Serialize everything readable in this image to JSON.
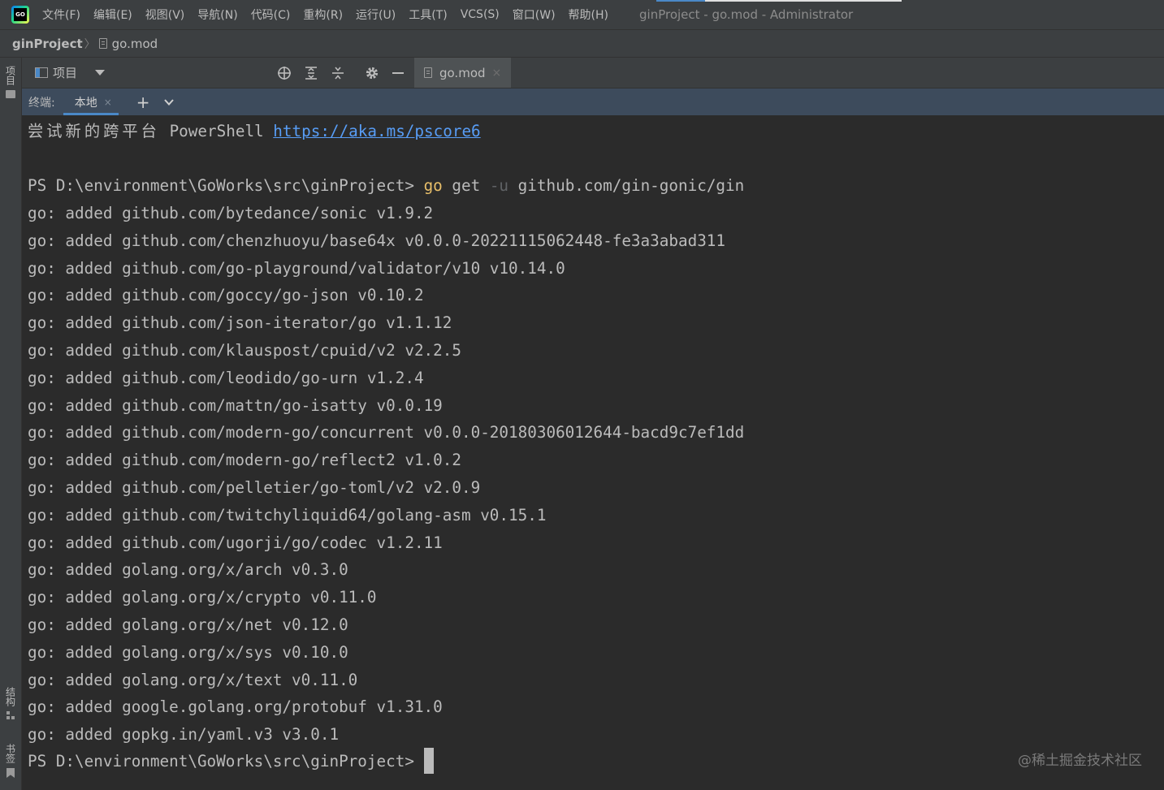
{
  "menubar": {
    "items": [
      "文件(F)",
      "编辑(E)",
      "视图(V)",
      "导航(N)",
      "代码(C)",
      "重构(R)",
      "运行(U)",
      "工具(T)",
      "VCS(S)",
      "窗口(W)",
      "帮助(H)"
    ],
    "window_title": "ginProject - go.mod - Administrator"
  },
  "breadcrumb": {
    "project": "ginProject",
    "file": "go.mod"
  },
  "left_stripe": {
    "project_label": "项目",
    "structure_label": "结构",
    "bookmarks_label": "书签"
  },
  "project_panel": {
    "title": "项目"
  },
  "editor": {
    "tab_label": "go.mod"
  },
  "terminal_header": {
    "label": "终端:",
    "tab_label": "本地"
  },
  "terminal": {
    "intro_text": "尝试新的跨平台",
    "intro_mid": " PowerShell ",
    "intro_link": "https://aka.ms/pscore6",
    "prompt": "PS D:\\environment\\GoWorks\\src\\ginProject> ",
    "command_name": "go",
    "command_sub": " get ",
    "command_flag": "-u",
    "command_arg": " github.com/gin-gonic/gin",
    "output_lines": [
      "go: added github.com/bytedance/sonic v1.9.2",
      "go: added github.com/chenzhuoyu/base64x v0.0.0-20221115062448-fe3a3abad311",
      "go: added github.com/go-playground/validator/v10 v10.14.0",
      "go: added github.com/goccy/go-json v0.10.2",
      "go: added github.com/json-iterator/go v1.1.12",
      "go: added github.com/klauspost/cpuid/v2 v2.2.5",
      "go: added github.com/leodido/go-urn v1.2.4",
      "go: added github.com/mattn/go-isatty v0.0.19",
      "go: added github.com/modern-go/concurrent v0.0.0-20180306012644-bacd9c7ef1dd",
      "go: added github.com/modern-go/reflect2 v1.0.2",
      "go: added github.com/pelletier/go-toml/v2 v2.0.9",
      "go: added github.com/twitchyliquid64/golang-asm v0.15.1",
      "go: added github.com/ugorji/go/codec v1.2.11",
      "go: added golang.org/x/arch v0.3.0",
      "go: added golang.org/x/crypto v0.11.0",
      "go: added golang.org/x/net v0.12.0",
      "go: added golang.org/x/sys v0.10.0",
      "go: added golang.org/x/text v0.11.0",
      "go: added google.golang.org/protobuf v1.31.0",
      "go: added gopkg.in/yaml.v3 v3.0.1"
    ],
    "final_prompt": "PS D:\\environment\\GoWorks\\src\\ginProject> "
  },
  "watermark": "@稀土掘金技术社区",
  "colors": {
    "background": "#2b2b2b",
    "toolbar": "#3c3f41",
    "terminal_header": "#3d4b5c",
    "accent": "#4a88c7",
    "link": "#589df6",
    "command": "#e8bf6a"
  }
}
